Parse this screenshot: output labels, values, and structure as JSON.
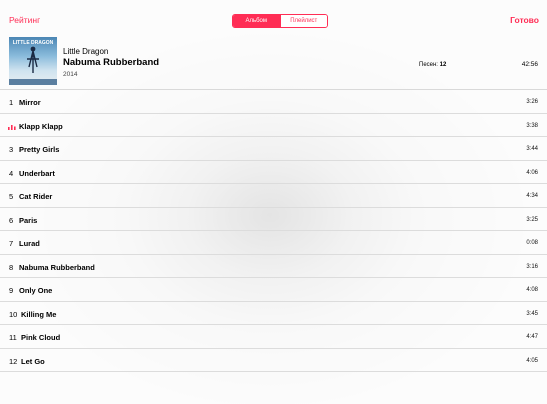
{
  "nav": {
    "left_label": "Рейтинг",
    "right_label": "Готово"
  },
  "segments": {
    "album": "Альбом",
    "playlist": "Плейлист",
    "selected": "album"
  },
  "album": {
    "artist": "Little Dragon",
    "title": "Nabuma Rubberband",
    "year": "2014",
    "songs_label": "Песен:",
    "songs_count": "12",
    "total_duration": "42:56",
    "cover_text": "LITTLE DRAGON"
  },
  "tracks": [
    {
      "num": "1",
      "title": "Mirror",
      "duration": "3:26",
      "playing": false
    },
    {
      "num": "",
      "title": "Klapp Klapp",
      "duration": "3:38",
      "playing": true
    },
    {
      "num": "3",
      "title": "Pretty Girls",
      "duration": "3:44",
      "playing": false
    },
    {
      "num": "4",
      "title": "Underbart",
      "duration": "4:06",
      "playing": false
    },
    {
      "num": "5",
      "title": "Cat Rider",
      "duration": "4:34",
      "playing": false
    },
    {
      "num": "6",
      "title": "Paris",
      "duration": "3:25",
      "playing": false
    },
    {
      "num": "7",
      "title": "Lurad",
      "duration": "0:08",
      "playing": false
    },
    {
      "num": "8",
      "title": "Nabuma Rubberband",
      "duration": "3:16",
      "playing": false
    },
    {
      "num": "9",
      "title": "Only One",
      "duration": "4:08",
      "playing": false
    },
    {
      "num": "10",
      "title": "Killing Me",
      "duration": "3:45",
      "playing": false
    },
    {
      "num": "11",
      "title": "Pink Cloud",
      "duration": "4:47",
      "playing": false
    },
    {
      "num": "12",
      "title": "Let Go",
      "duration": "4:05",
      "playing": false
    }
  ],
  "colors": {
    "accent": "#ff2d55"
  }
}
